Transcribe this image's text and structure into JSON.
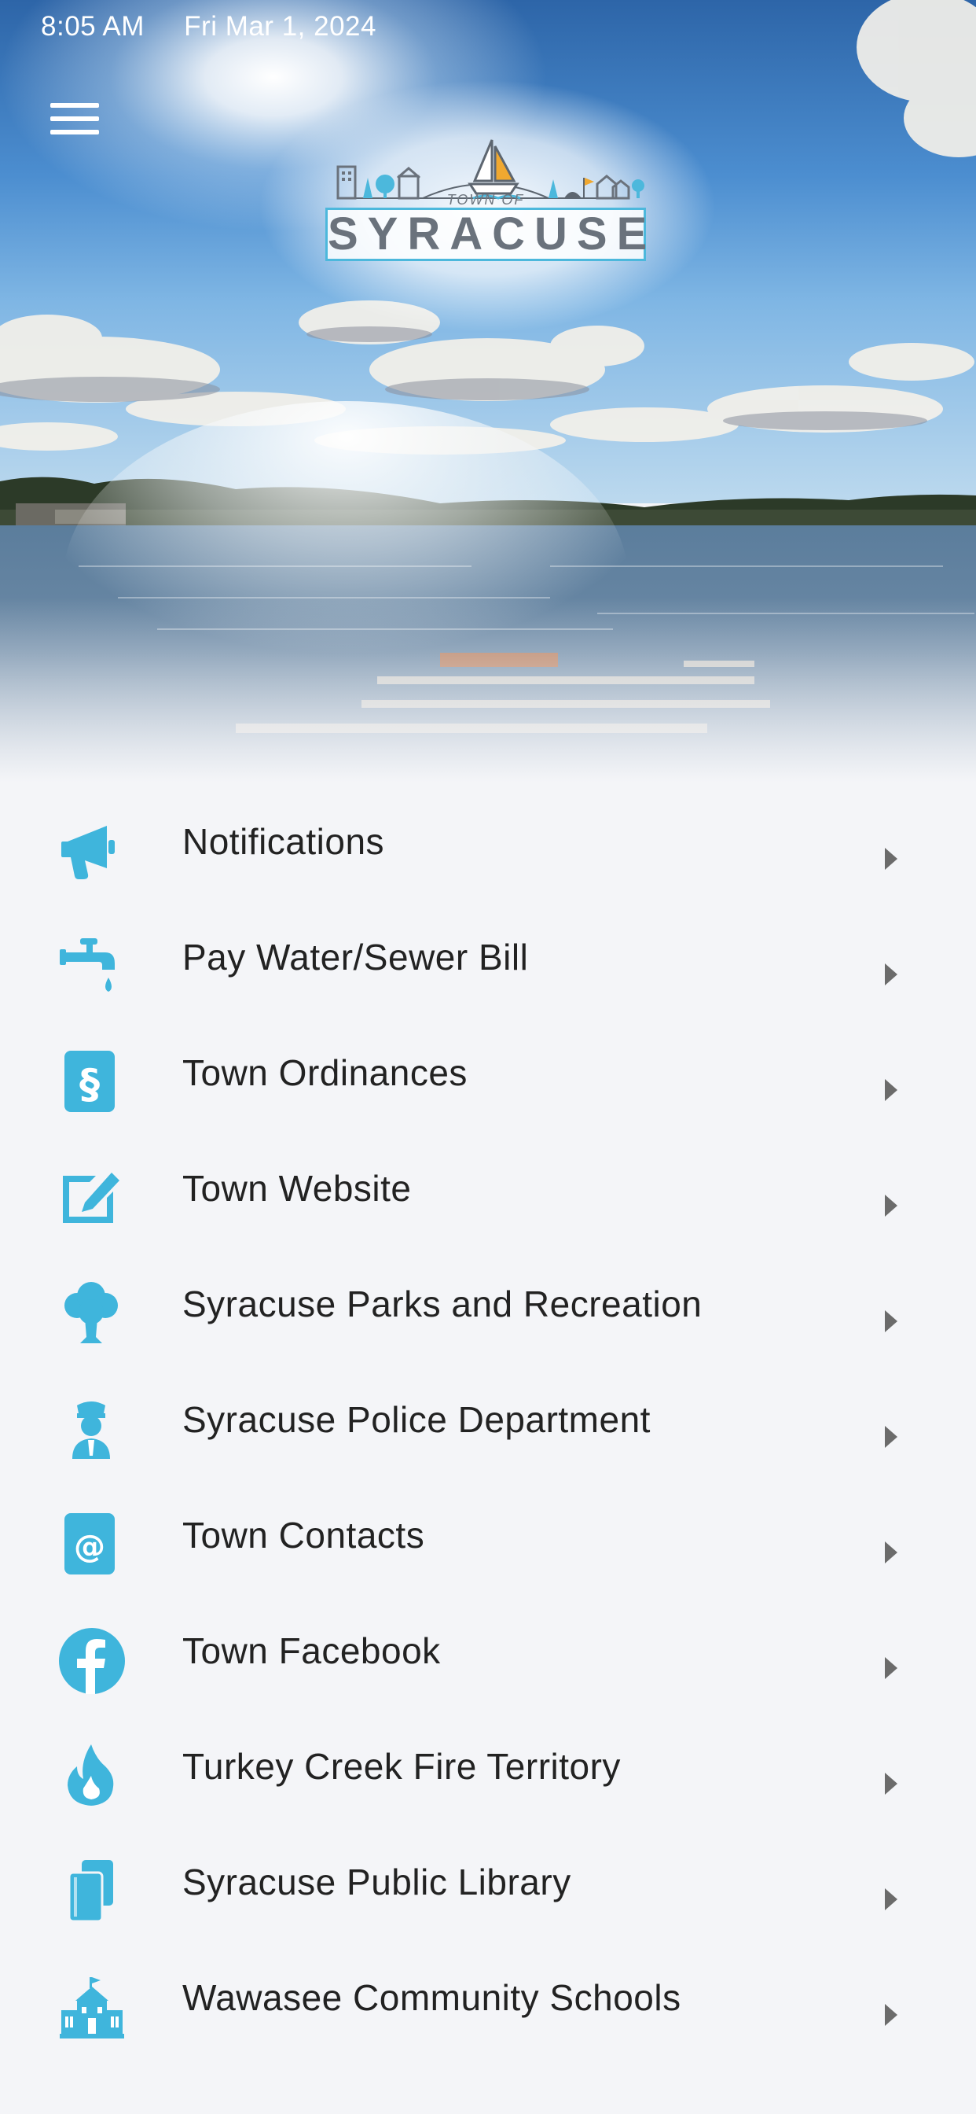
{
  "status_bar": {
    "time": "8:05 AM",
    "date": "Fri Mar 1, 2024"
  },
  "header": {
    "menu_icon": "hamburger-menu-icon",
    "logo": {
      "town_of": "TOWN OF",
      "name": "SYRACUSE"
    }
  },
  "colors": {
    "icon_accent": "#3fb5dc",
    "background": "#f4f5f8",
    "text": "#222222",
    "chevron": "#6b6b6b"
  },
  "menu": {
    "items": [
      {
        "label": "Notifications",
        "icon": "megaphone-icon"
      },
      {
        "label": "Pay Water/Sewer Bill",
        "icon": "faucet-icon"
      },
      {
        "label": "Town Ordinances",
        "icon": "section-document-icon"
      },
      {
        "label": "Town Website",
        "icon": "edit-square-icon"
      },
      {
        "label": "Syracuse Parks and Recreation",
        "icon": "tree-icon"
      },
      {
        "label": "Syracuse Police Department",
        "icon": "police-officer-icon"
      },
      {
        "label": "Town Contacts",
        "icon": "at-contact-icon"
      },
      {
        "label": "Town Facebook",
        "icon": "facebook-icon"
      },
      {
        "label": "Turkey Creek Fire Territory",
        "icon": "fire-icon"
      },
      {
        "label": "Syracuse Public Library",
        "icon": "books-icon"
      },
      {
        "label": "Wawasee Community Schools",
        "icon": "school-icon"
      }
    ]
  }
}
